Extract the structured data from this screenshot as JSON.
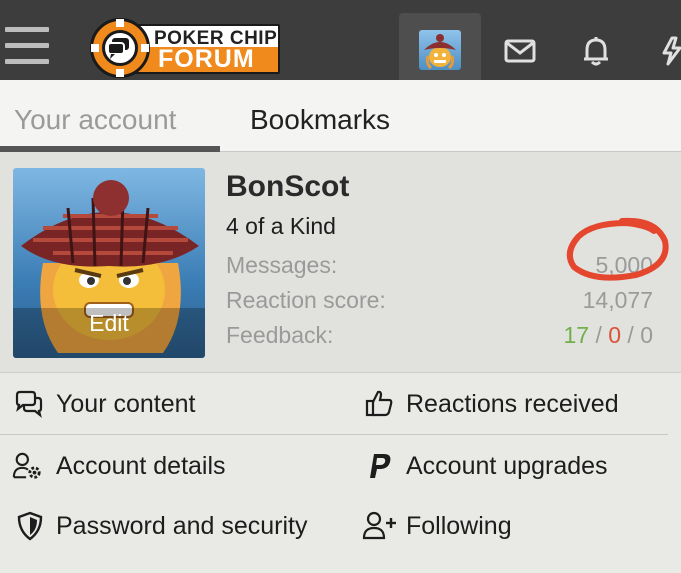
{
  "header": {
    "logo_top": "POKER CHIP",
    "logo_bottom": "FORUM",
    "icons": [
      "menu-icon",
      "avatar",
      "mail-icon",
      "bell-icon",
      "bolt-icon"
    ]
  },
  "tabs": [
    {
      "label": "Your account",
      "active": true
    },
    {
      "label": "Bookmarks",
      "active": false
    }
  ],
  "profile": {
    "username": "BonScot",
    "rank": "4 of a Kind",
    "avatar_edit": "Edit",
    "stats": {
      "messages_label": "Messages:",
      "messages_value": "5,000",
      "reaction_label": "Reaction score:",
      "reaction_value": "14,077",
      "feedback_label": "Feedback:",
      "feedback_positive": "17",
      "feedback_negative": "0",
      "feedback_neutral": "0",
      "feedback_sep": "/"
    }
  },
  "menu": {
    "your_content": "Your content",
    "reactions_received": "Reactions received",
    "account_details": "Account details",
    "account_upgrades": "Account upgrades",
    "password_security": "Password and security",
    "following": "Following"
  },
  "colors": {
    "topbar": "#3d3d3d",
    "brand_orange": "#f08a1c",
    "annotation_red": "#e4472e",
    "feedback_positive": "#6fb04b",
    "feedback_negative": "#d9533b"
  }
}
